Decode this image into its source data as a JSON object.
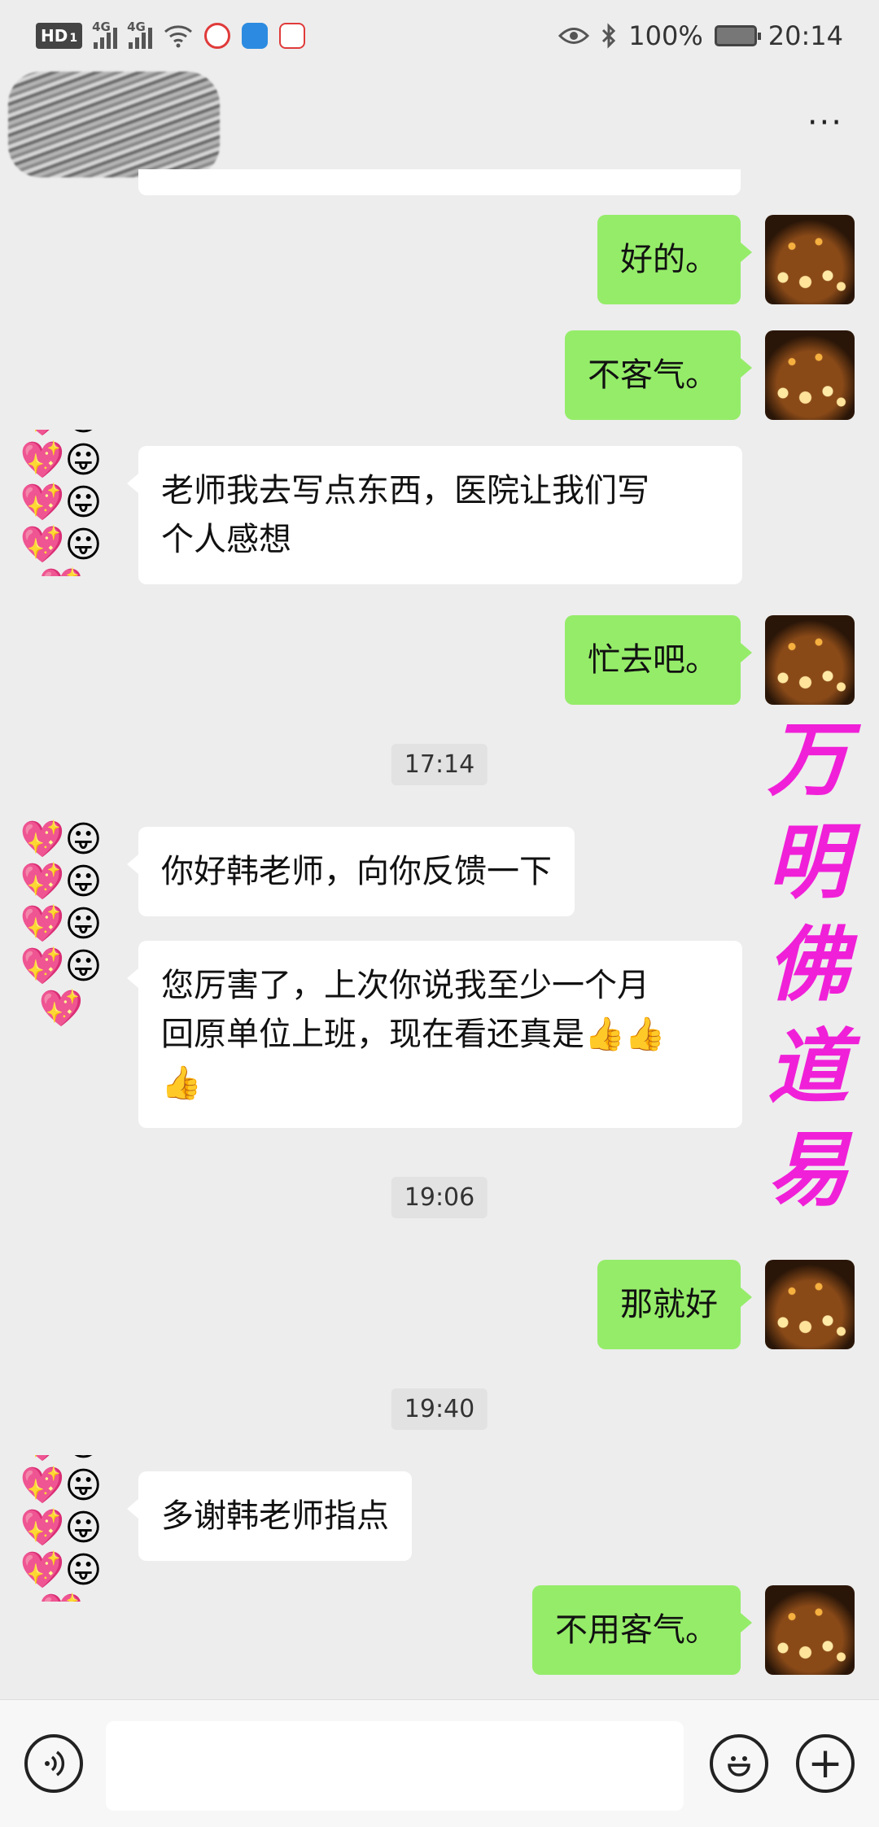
{
  "status_bar": {
    "hd_label": "HD",
    "sim_slot": "1",
    "network_1": "4G",
    "network_2": "4G",
    "battery_percent": "100%",
    "time": "20:14",
    "icons": [
      "hd-icon",
      "signal-icon",
      "signal-icon",
      "wifi-icon",
      "app-notification-icon",
      "app-notification-icon",
      "app-notification-icon",
      "eye-icon",
      "bluetooth-icon",
      "battery-icon"
    ]
  },
  "header": {
    "more_label": "···"
  },
  "messages": [
    {
      "dir": "out",
      "text": "好的。"
    },
    {
      "dir": "out",
      "text": "不客气。"
    },
    {
      "dir": "in",
      "text": "老师我去写点东西，医院让我们写\n个人感想"
    },
    {
      "dir": "out",
      "text": "忙去吧。"
    },
    {
      "type": "time",
      "text": "17:14"
    },
    {
      "dir": "in",
      "text": "你好韩老师，向你反馈一下"
    },
    {
      "dir": "in",
      "text": "您厉害了，上次你说我至少一个月\n回原单位上班，现在看还真是👍👍\n👍"
    },
    {
      "type": "time",
      "text": "19:06"
    },
    {
      "dir": "out",
      "text": "那就好"
    },
    {
      "type": "time",
      "text": "19:40"
    },
    {
      "dir": "in",
      "text": "多谢韩老师指点"
    },
    {
      "dir": "out",
      "text": "不用客气。"
    }
  ],
  "watermark": {
    "chars": [
      "万",
      "明",
      "佛",
      "道",
      "易"
    ],
    "color": "#f020d8"
  },
  "emoji_avatar": "💖😛💖😛💖😛💖😛💖",
  "colors": {
    "background": "#ededed",
    "outgoing_bubble": "#95ec69",
    "incoming_bubble": "#ffffff"
  },
  "input_bar": {
    "voice_icon": "voice-icon",
    "emoji_icon": "emoji-icon",
    "plus_label": "+",
    "placeholder": ""
  }
}
